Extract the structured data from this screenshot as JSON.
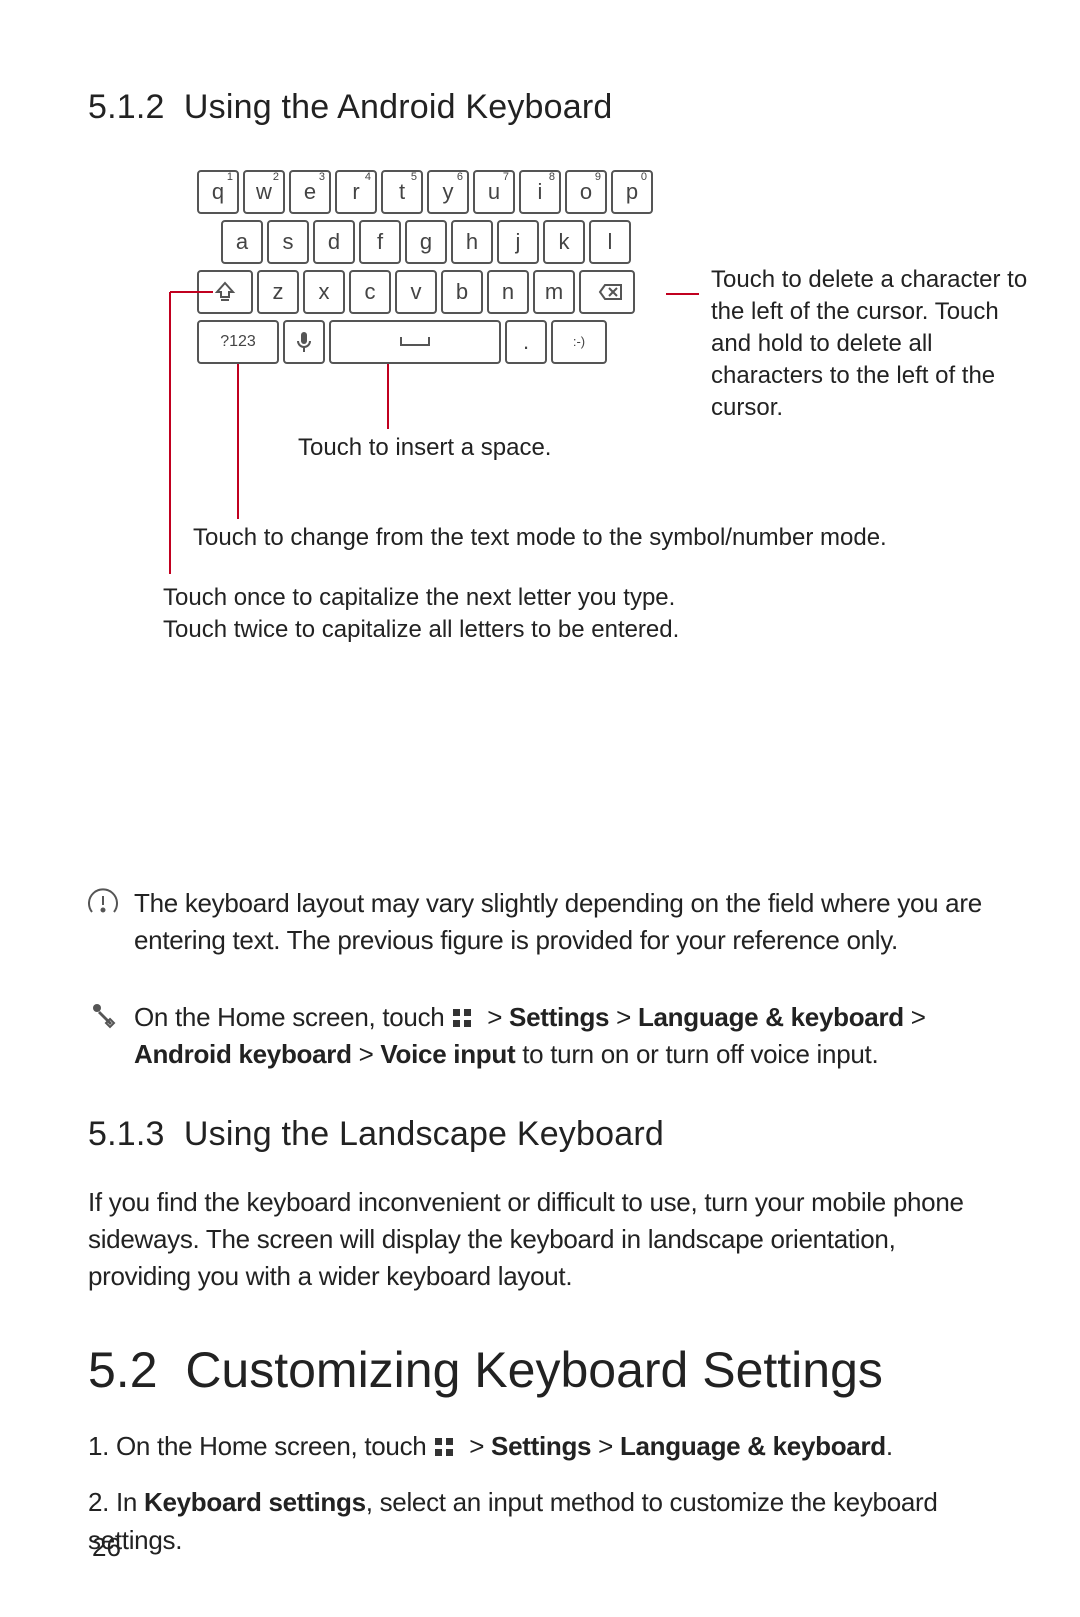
{
  "heading_512_num": "5.1.2",
  "heading_512_text": "Using the Android Keyboard",
  "kb": {
    "row1": [
      {
        "c": "q",
        "s": "1"
      },
      {
        "c": "w",
        "s": "2"
      },
      {
        "c": "e",
        "s": "3"
      },
      {
        "c": "r",
        "s": "4"
      },
      {
        "c": "t",
        "s": "5"
      },
      {
        "c": "y",
        "s": "6"
      },
      {
        "c": "u",
        "s": "7"
      },
      {
        "c": "i",
        "s": "8"
      },
      {
        "c": "o",
        "s": "9"
      },
      {
        "c": "p",
        "s": "0"
      }
    ],
    "row2": [
      "a",
      "s",
      "d",
      "f",
      "g",
      "h",
      "j",
      "k",
      "l"
    ],
    "row3_mid": [
      "z",
      "x",
      "c",
      "v",
      "b",
      "n",
      "m"
    ],
    "num_key": "?123",
    "period": ".",
    "smiley": ":-)"
  },
  "lbl_delete": "Touch to delete a character to the left of the cursor. Touch and hold to delete all characters to the left of the cursor.",
  "lbl_space": "Touch to insert a space.",
  "lbl_symbols": "Touch to change from the text mode to the symbol/number mode.",
  "lbl_shift1": "Touch once to capitalize the next letter you type.",
  "lbl_shift2": "Touch twice to capitalize all letters to be entered.",
  "note1": "The keyboard layout may vary slightly depending on the field where you are entering text. The previous figure is provided for your reference only.",
  "tip_pre": "On the Home screen, touch ",
  "tip_s1": "Settings",
  "tip_s2": "Language & keyboard",
  "tip_s3": "Android keyboard",
  "tip_s4": "Voice input",
  "tip_post": " to turn on or turn off voice input.",
  "heading_513_num": "5.1.3",
  "heading_513_text": "Using the Landscape Keyboard",
  "para_513": "If you find the keyboard inconvenient or difficult to use, turn your mobile phone sideways. The screen will display the keyboard in landscape orientation, providing you with a wider keyboard layout.",
  "heading_52_num": "5.2",
  "heading_52_text": "Customizing Keyboard Settings",
  "step1_pre": "1. On the Home screen, touch ",
  "step1_s1": "Settings",
  "step1_s2": "Language & keyboard",
  "step2_pre": "2. In ",
  "step2_b": "Keyboard settings",
  "step2_post": ", select an input method to customize the keyboard settings.",
  "page_number": "26"
}
